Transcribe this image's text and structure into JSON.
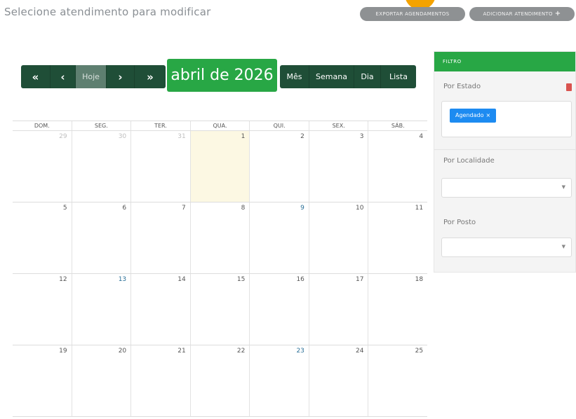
{
  "page": {
    "title": "Selecione atendimento para modificar"
  },
  "actions": {
    "export_label": "EXPORTAR AGENDAMENTOS",
    "add_label": "ADICIONAR ATENDIMENTO",
    "add_icon": "plus-icon"
  },
  "toolbar": {
    "prev_year": "«",
    "prev": "‹",
    "today": "Hoje",
    "next": "›",
    "next_year": "»",
    "month_title": "abril de 2026",
    "views": [
      "Mês",
      "Semana",
      "Dia",
      "Lista"
    ]
  },
  "calendar": {
    "weekdays": [
      "DOM.",
      "SEG.",
      "TER.",
      "QUA.",
      "QUI.",
      "SEX.",
      "SÁB."
    ],
    "weeks": [
      [
        "29",
        "30",
        "31",
        "1",
        "2",
        "3",
        "4"
      ],
      [
        "5",
        "6",
        "7",
        "8",
        "9",
        "10",
        "11"
      ],
      [
        "12",
        "13",
        "14",
        "15",
        "16",
        "17",
        "18"
      ],
      [
        "19",
        "20",
        "21",
        "22",
        "23",
        "24",
        "25"
      ]
    ],
    "today": "1"
  },
  "filter": {
    "header": "FILTRO",
    "estado_label": "Por Estado",
    "estado_tag": "Agendado",
    "estado_tag_remove": "×",
    "localidade_label": "Por Localidade",
    "localidade_value": "",
    "posto_label": "Por Posto",
    "posto_value": "",
    "colors": {
      "accent": "#28a745",
      "toolbar": "#1f4e37",
      "tag": "#1d8bf1"
    }
  }
}
